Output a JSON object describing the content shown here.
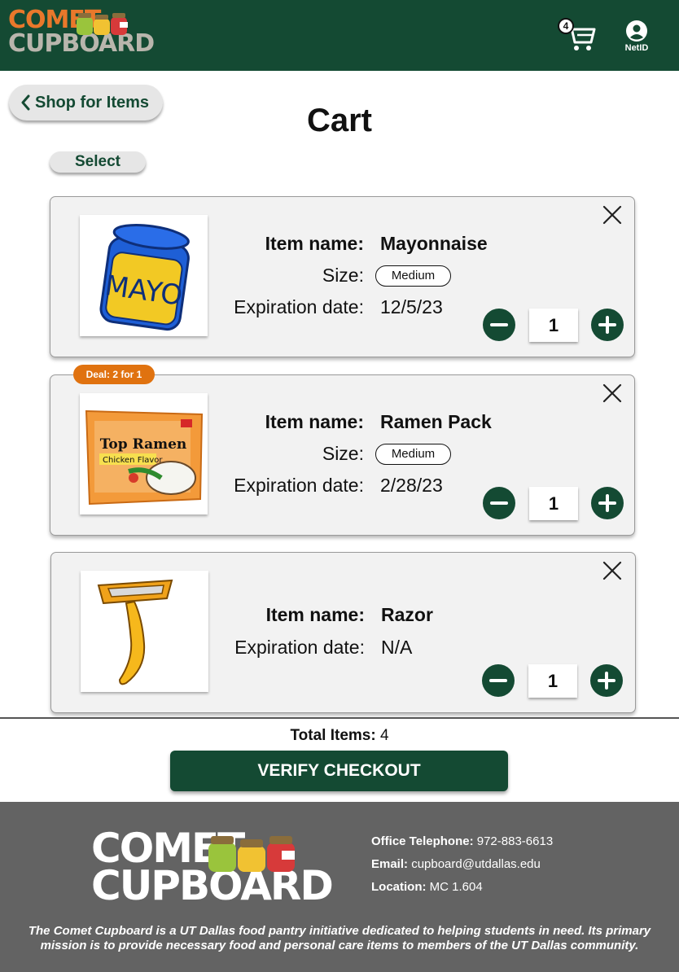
{
  "header": {
    "logo_line1": "COMET",
    "logo_line2": "CUPBOARD",
    "cart_count": "4",
    "netid_label": "NetID"
  },
  "nav": {
    "back_label": "Shop for Items",
    "title": "Cart",
    "select_label": "Select"
  },
  "labels": {
    "item_name": "Item name:",
    "size": "Size:",
    "expiration": "Expiration date:"
  },
  "items": [
    {
      "name": "Mayonnaise",
      "size": "Medium",
      "expiration": "12/5/23",
      "quantity": "1",
      "image_label": "MAYO"
    },
    {
      "name": "Ramen Pack",
      "size": "Medium",
      "expiration": "2/28/23",
      "quantity": "1",
      "deal": "Deal: 2 for 1",
      "image_label": "Top Ramen",
      "image_sub": "Chicken Flavor"
    },
    {
      "name": "Razor",
      "expiration": "N/A",
      "quantity": "1"
    }
  ],
  "summary": {
    "total_label": "Total Items:",
    "total_value": "4",
    "verify_label": "VERIFY CHECKOUT"
  },
  "footer": {
    "logo_line1": "COMET",
    "logo_line2": "CUPBOARD",
    "phone_label": "Office Telephone:",
    "phone": "972-883-6613",
    "email_label": "Email:",
    "email": "cupboard@utdallas.edu",
    "location_label": "Location:",
    "location": "MC 1.604",
    "about": "The Comet Cupboard is a UT Dallas food pantry initiative dedicated to helping students in need. Its primary mission is to provide necessary food and personal care items to members of the UT Dallas community."
  },
  "colors": {
    "brand_green": "#144a33",
    "brand_orange": "#e9782b",
    "deal_orange": "#e0720f",
    "footer_gray": "#636363"
  }
}
